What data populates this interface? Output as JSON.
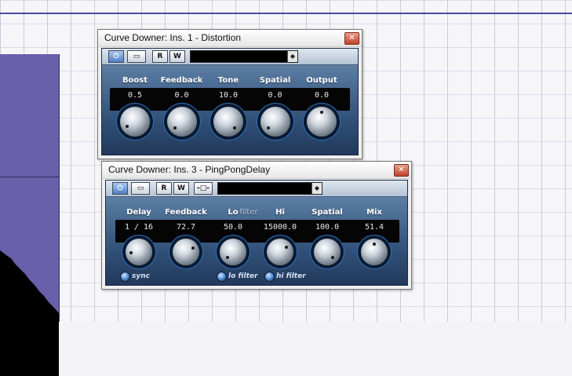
{
  "distortion": {
    "title": "Curve Downer: Ins. 1 - Distortion",
    "close": "✕",
    "toolbar": {
      "bypass_icon": "power-icon",
      "monitor": "▭",
      "read": "R",
      "write": "W",
      "preset_dropdown": "◆"
    },
    "params": [
      {
        "label": "Boost",
        "value": "0.5",
        "level": 0.05
      },
      {
        "label": "Feedback",
        "value": "0.0",
        "level": 0.0
      },
      {
        "label": "Tone",
        "value": "10.0",
        "level": 1.0
      },
      {
        "label": "Spatial",
        "value": "0.0",
        "level": 0.0
      },
      {
        "label": "Output",
        "value": "0.0",
        "level": 0.5
      }
    ]
  },
  "pingpong": {
    "title": "Curve Downer: Ins. 3 - PingPongDelay",
    "close": "✕",
    "toolbar": {
      "bypass_icon": "power-icon",
      "monitor": "▭",
      "read": "R",
      "write": "W",
      "sidechain": "-□-",
      "preset_dropdown": "◆"
    },
    "filter_label": "filter",
    "params": [
      {
        "label": "Delay",
        "value": "1 / 16",
        "level": 0.15
      },
      {
        "label": "Feedback",
        "value": "72.7",
        "level": 0.73
      },
      {
        "label": "Lo",
        "value": "50.0",
        "level": 0.0
      },
      {
        "label": "Hi",
        "value": "15000.0",
        "level": 0.7
      },
      {
        "label": "Spatial",
        "value": "100.0",
        "level": 1.0
      },
      {
        "label": "Mix",
        "value": "51.4",
        "level": 0.51
      }
    ],
    "switches": {
      "sync": "sync",
      "lo_filter": "lo filter",
      "hi_filter": "hi filter"
    }
  }
}
